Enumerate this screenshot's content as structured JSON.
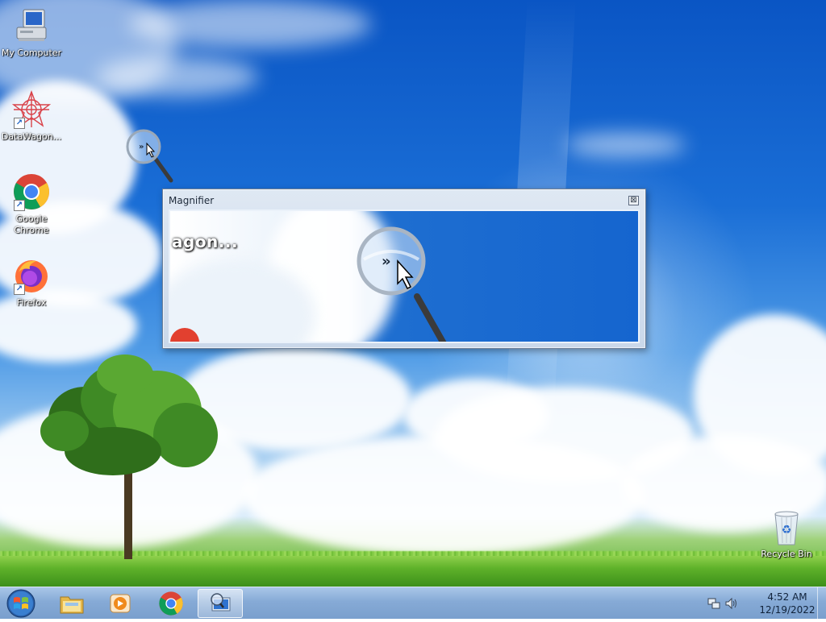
{
  "desktop": {
    "icons": [
      {
        "label": "My Computer",
        "icon": "computer-icon"
      },
      {
        "label": "DataWagon...",
        "icon": "datawagon-icon",
        "shortcut": true
      },
      {
        "label": "Google Chrome",
        "icon": "chrome-icon",
        "shortcut": true
      },
      {
        "label": "Firefox",
        "icon": "firefox-icon",
        "shortcut": true
      },
      {
        "label": "Recycle Bin",
        "icon": "recycle-bin-icon"
      }
    ]
  },
  "magnifier": {
    "title": "Magnifier",
    "close_glyph": "⊠",
    "zoomed_text": "agon..."
  },
  "taskbar": {
    "apps": [
      {
        "name": "Windows Explorer",
        "icon": "folder-icon"
      },
      {
        "name": "Windows Media Player",
        "icon": "media-player-icon"
      },
      {
        "name": "Google Chrome",
        "icon": "chrome-icon"
      },
      {
        "name": "Magnifier",
        "icon": "magnifier-icon",
        "active": true
      }
    ],
    "clock": {
      "time": "4:52 AM",
      "date": "12/19/2022"
    }
  },
  "colors": {
    "taskbar": "#86aad6",
    "sky": "#1a6ed6",
    "grass": "#5fb22a"
  }
}
